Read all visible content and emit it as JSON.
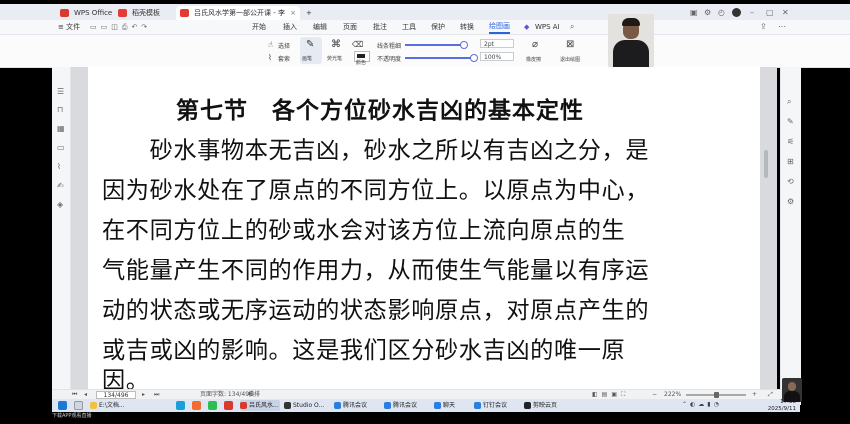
{
  "tabs": {
    "items": [
      {
        "label": "WPS Office",
        "color": "#d93a2b"
      },
      {
        "label": "稻壳模板",
        "color": "#e53935"
      },
      {
        "label": "吕氏风水学第一部公开课 - 李",
        "color": "#e53935"
      }
    ],
    "new_tab": "+"
  },
  "menu": {
    "file": "≡ 文件",
    "items": [
      "开始",
      "插入",
      "编辑",
      "页面",
      "批注",
      "工具",
      "保护",
      "转换",
      "绘图画"
    ],
    "active_index": 8,
    "wps_ai": "WPS AI"
  },
  "ribbon": {
    "select": "选择",
    "lasso": "套索",
    "erase": "橡皮擦",
    "stroke_width": "线条粗细",
    "color": "颜色",
    "transparency": "不透明度",
    "size_value": "2pt",
    "opacity_value": "100%",
    "eraser": "橡皮擦",
    "exit": "退出绘图"
  },
  "document": {
    "heading": "第七节　各个方位砂水吉凶的基本定性",
    "lines": [
      "　　砂水事物本无吉凶，砂水之所以有吉凶之分，是",
      "因为砂水处在了原点的不同方位上。以原点为中心，",
      "在不同方位上的砂或水会对该方位上流向原点的生",
      "气能量产生不同的作用力，从而使生气能量以有序运",
      "动的状态或无序运动的状态影响原点，对原点产生的",
      "或吉或凶的影响。这是我们区分砂水吉凶的唯一原",
      "因。"
    ]
  },
  "status": {
    "page_info": "134/496",
    "word_count": "页面字数: 134/496",
    "mode": "横排",
    "zoom": "222%"
  },
  "taskbar": {
    "items": [
      "E:\\文档...",
      "吕氏风水...",
      "Studio O...",
      "腾讯会议",
      "腾讯会议",
      "聊天",
      "钉钉会议",
      "剪映云页"
    ],
    "time": "17:38",
    "date": "2025/9/11"
  },
  "footer_text": "下载APP观看直播"
}
